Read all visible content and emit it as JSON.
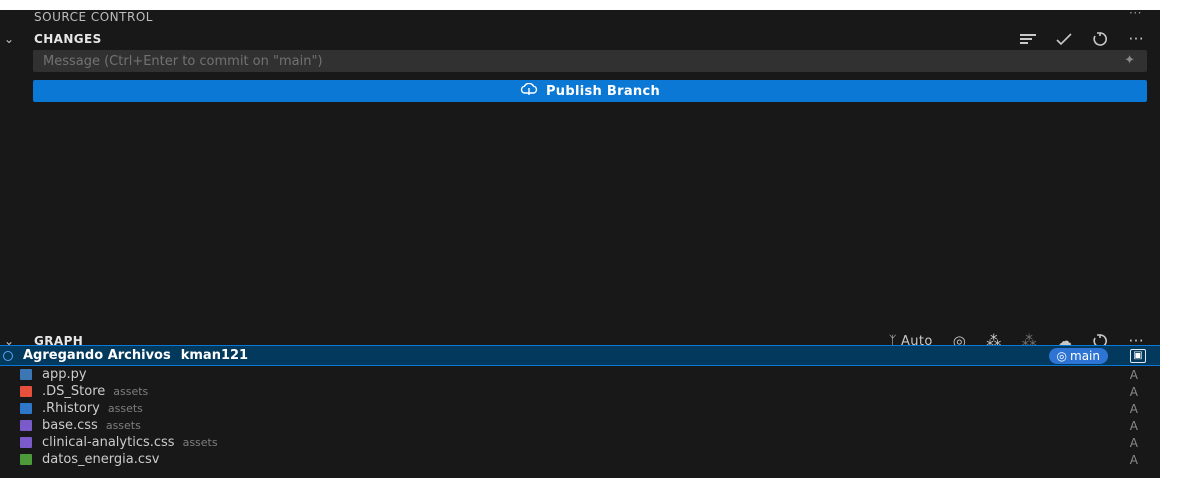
{
  "panel": {
    "title": "SOURCE CONTROL",
    "title_more": "···"
  },
  "changes": {
    "label": "CHANGES",
    "commit_placeholder": "Message (Ctrl+Enter to commit on \"main\")",
    "publish_label": "Publish Branch",
    "toolbar_icons": [
      "view-as-tree-icon",
      "commit-check-icon",
      "refresh-icon",
      "more-actions-icon"
    ]
  },
  "graph": {
    "label": "GRAPH",
    "auto_label": "Auto",
    "toolbar_icons": [
      "branch-picker-icon",
      "go-to-current-icon",
      "fetch-icon",
      "pull-icon",
      "push-icon",
      "refresh-icon",
      "more-actions-icon"
    ],
    "commit": {
      "message": "Agregando Archivos",
      "author": "kman121",
      "branch": "main"
    },
    "files": [
      {
        "name": "app.py",
        "path": "",
        "icon": "python-file-icon",
        "color": "#3a77b4"
      },
      {
        "name": ".DS_Store",
        "path": "assets",
        "icon": "ds-store-file-icon",
        "color": "#e6503c"
      },
      {
        "name": ".Rhistory",
        "path": "assets",
        "icon": "r-file-icon",
        "color": "#2f77c9"
      },
      {
        "name": "base.css",
        "path": "assets",
        "icon": "css-file-icon",
        "color": "#7b5bc9"
      },
      {
        "name": "clinical-analytics.css",
        "path": "assets",
        "icon": "css-file-icon",
        "color": "#7b5bc9"
      },
      {
        "name": "datos_energia.csv",
        "path": "",
        "icon": "csv-file-icon",
        "color": "#4c9a3a"
      }
    ],
    "file_status": "A"
  },
  "colors": {
    "background": "#181818",
    "accent": "#0a78d4",
    "selection": "#04395e"
  }
}
